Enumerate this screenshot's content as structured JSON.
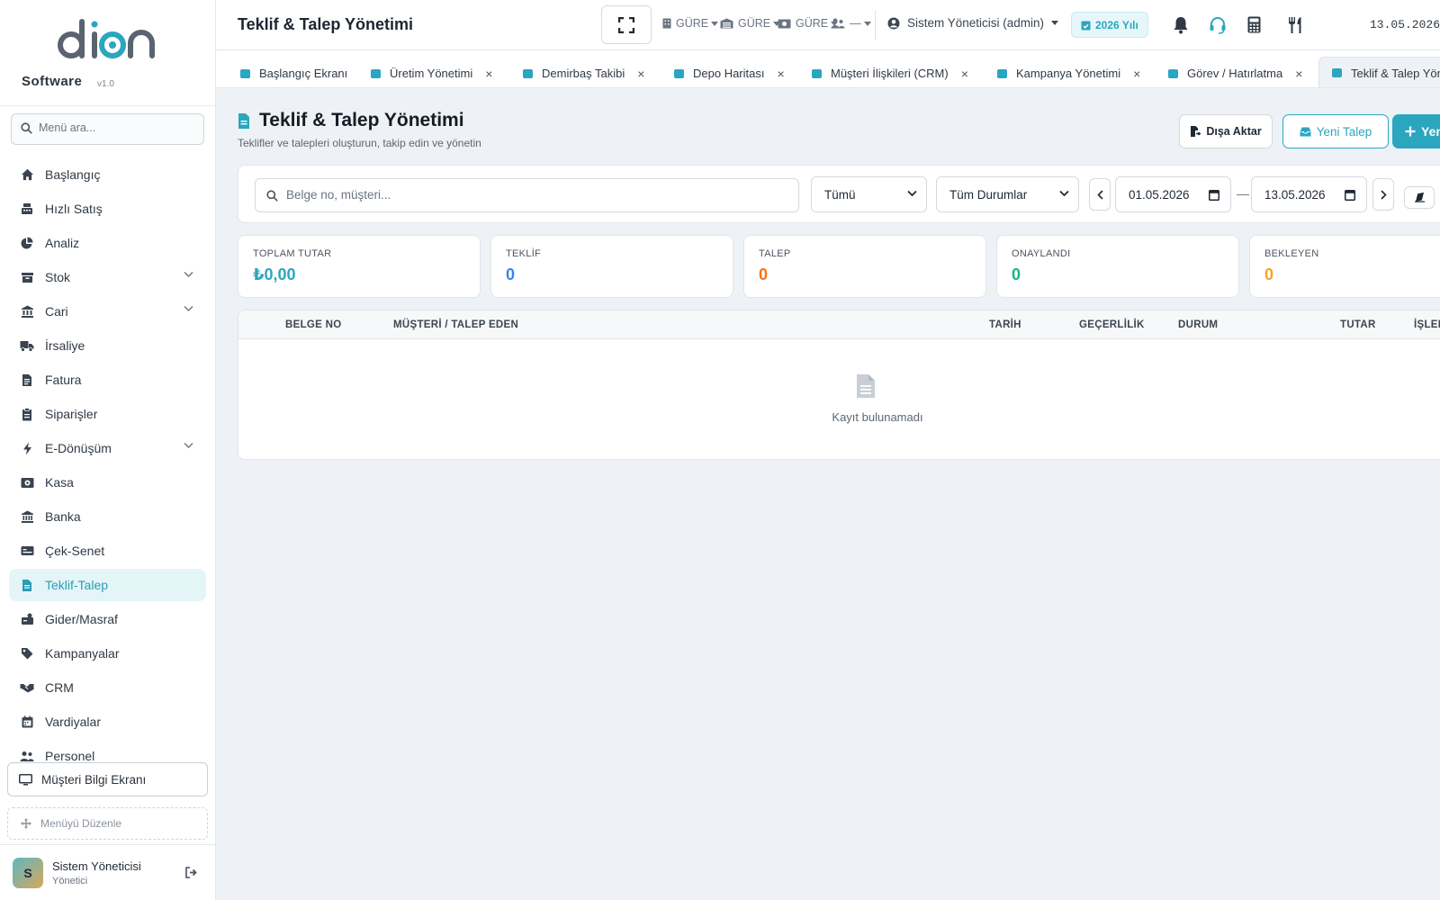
{
  "sidebar": {
    "brand": "Software",
    "version": "v1.0",
    "search_placeholder": "Menü ara...",
    "items": [
      {
        "label": "Başlangıç",
        "icon": "home-icon"
      },
      {
        "label": "Hızlı Satış",
        "icon": "cash-register-icon"
      },
      {
        "label": "Analiz",
        "icon": "pie-chart-icon"
      },
      {
        "label": "Stok",
        "icon": "boxes-icon",
        "expandable": true
      },
      {
        "label": "Cari",
        "icon": "building-icon",
        "expandable": true
      },
      {
        "label": "İrsaliye",
        "icon": "truck-icon"
      },
      {
        "label": "Fatura",
        "icon": "invoice-icon"
      },
      {
        "label": "Siparişler",
        "icon": "clipboard-icon"
      },
      {
        "label": "E-Dönüşüm",
        "icon": "bolt-icon",
        "expandable": true
      },
      {
        "label": "Kasa",
        "icon": "safe-icon"
      },
      {
        "label": "Banka",
        "icon": "bank-icon"
      },
      {
        "label": "Çek-Senet",
        "icon": "check-card-icon"
      },
      {
        "label": "Teklif-Talep",
        "icon": "document-icon",
        "active": true
      },
      {
        "label": "Gider/Masraf",
        "icon": "expense-icon"
      },
      {
        "label": "Kampanyalar",
        "icon": "tag-icon"
      },
      {
        "label": "CRM",
        "icon": "handshake-icon"
      },
      {
        "label": "Vardiyalar",
        "icon": "calendar-icon"
      },
      {
        "label": "Personel",
        "icon": "users-icon"
      }
    ],
    "customer_screen_label": "Müşteri Bilgi Ekranı",
    "edit_menu_label": "Menüyü Düzenle",
    "user": {
      "initial": "S",
      "name": "Sistem Yöneticisi",
      "role": "Yönetici"
    }
  },
  "topbar": {
    "title": "Teklif & Talep Yönetimi",
    "branch_label": "GÜRE",
    "warehouse_label": "GÜRE",
    "register_label": "GÜRE",
    "staff_label": "—",
    "user_label": "Sistem Yöneticisi (admin)",
    "year_label": "2026 Yılı",
    "date": "13.05.2026"
  },
  "tabs": [
    {
      "label": "Başlangıç Ekranı",
      "closable": false
    },
    {
      "label": "Üretim Yönetimi",
      "closable": true
    },
    {
      "label": "Demirbaş Takibi",
      "closable": true
    },
    {
      "label": "Depo Haritası",
      "closable": true
    },
    {
      "label": "Müşteri İlişkileri (CRM)",
      "closable": true
    },
    {
      "label": "Kampanya Yönetimi",
      "closable": true
    },
    {
      "label": "Görev / Hatırlatma",
      "closable": true
    },
    {
      "label": "Teklif & Talep Yönetimi",
      "closable": true,
      "active": true
    }
  ],
  "page": {
    "title": "Teklif & Talep Yönetimi",
    "subtitle": "Teklifler ve talepleri oluşturun, takip edin ve yönetin",
    "export_label": "Dışa Aktar",
    "new_request_label": "Yeni Talep",
    "new_quote_label": "Yeni"
  },
  "filters": {
    "search_placeholder": "Belge no, müşteri...",
    "type_selected": "Tümü",
    "status_selected": "Tüm Durumlar",
    "date_from": "01.05.2026",
    "date_to": "13.05.2026",
    "separator": "—"
  },
  "stats": [
    {
      "label": "TOPLAM TUTAR",
      "value": "₺0,00",
      "color": "#2ba6bf"
    },
    {
      "label": "TEKLİF",
      "value": "0",
      "color": "#3b82f6"
    },
    {
      "label": "TALEP",
      "value": "0",
      "color": "#f97316"
    },
    {
      "label": "ONAYLANDI",
      "value": "0",
      "color": "#10b981"
    },
    {
      "label": "BEKLEYEN",
      "value": "0",
      "color": "#f5a524"
    }
  ],
  "table": {
    "columns": [
      "BELGE NO",
      "MÜŞTERİ / TALEP EDEN",
      "TARİH",
      "GEÇERLİLİK",
      "DURUM",
      "TUTAR",
      "İŞLEM"
    ],
    "rows": [],
    "empty_text": "Kayıt bulunamadı"
  },
  "colors": {
    "accent": "#2ba6bf",
    "active_bg": "#e4f5f8"
  }
}
